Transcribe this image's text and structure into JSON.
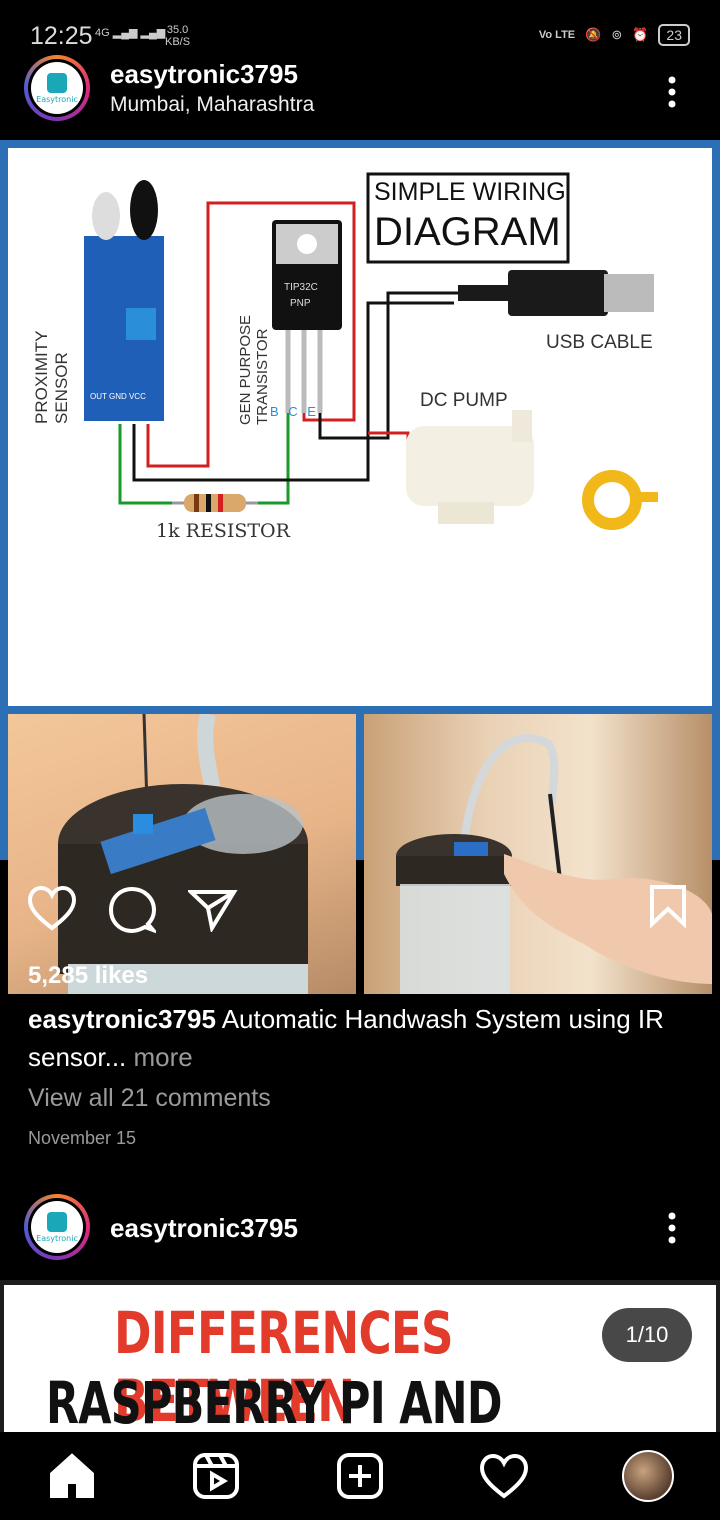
{
  "status_bar": {
    "time": "12:25",
    "network": "4G",
    "speed_value": "35.0",
    "speed_unit": "KB/S",
    "volte": "Vo LTE",
    "battery": "23"
  },
  "post": {
    "username": "easytronic3795",
    "location": "Mumbai, Maharashtra",
    "avatar_text": "Easytronic",
    "diagram": {
      "title_line1": "SIMPLE WIRING",
      "title_line2": "DIAGRAM",
      "label_sensor": "PROXIMITY SENSOR",
      "label_transistor": "GEN PURPOSE TRANSISTOR",
      "label_chip": "TIP32C",
      "label_pnp": "PNP",
      "label_pins": "B C E",
      "label_usb": "USB CABLE",
      "label_pump": "DC PUMP",
      "label_resistor": "1k RESISTOR",
      "label_sensor_pins": "OUT GND VCC"
    },
    "likes": "5,285 likes",
    "caption_user": "easytronic3795",
    "caption_text": " Automatic Handwash System using IR sensor",
    "caption_ellipsis": "...",
    "more_label": " more",
    "view_comments": "View all 21 comments",
    "date": "November 15"
  },
  "post2": {
    "username": "easytronic3795",
    "avatar_text": "Easytronic",
    "headline_line1": "DIFFERENCES BETWEEN",
    "headline_line2": "RASPBERRY PI AND ARDUINO?",
    "counter": "1/10"
  },
  "colors": {
    "brand_yellow": "#f2b81a",
    "headline_red": "#e23a2b",
    "frame_blue": "#2c6fb5"
  },
  "icons": [
    "heart-icon",
    "comment-icon",
    "share-icon",
    "bookmark-icon",
    "home-icon",
    "reels-icon",
    "new-post-icon",
    "activity-icon",
    "profile-avatar"
  ]
}
